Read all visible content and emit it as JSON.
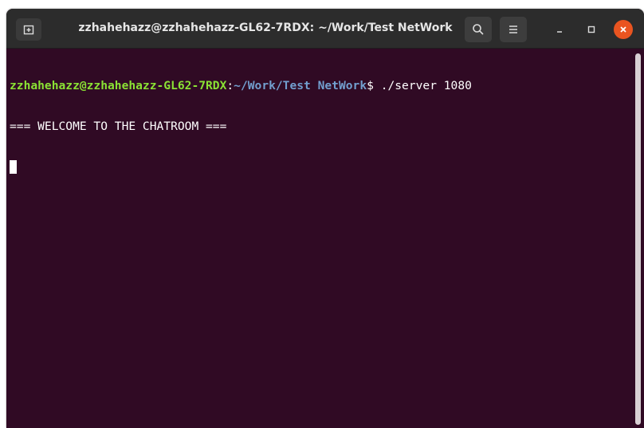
{
  "window": {
    "title": "zzhahehazz@zzhahehazz-GL62-7RDX: ~/Work/Test NetWork"
  },
  "toolbar": {
    "new_tab_icon": "new-tab-icon",
    "search_icon": "search-icon",
    "menu_icon": "hamburger-menu-icon",
    "minimize_icon": "minimize-icon",
    "maximize_icon": "maximize-icon",
    "close_icon": "close-icon"
  },
  "terminal": {
    "prompt_user": "zzhahehazz@zzhahehazz-GL62-7RDX",
    "prompt_colon": ":",
    "prompt_path": "~/Work/Test NetWork",
    "prompt_symbol": "$ ",
    "command": "./server 1080",
    "output_line": "=== WELCOME TO THE CHATROOM ==="
  },
  "colors": {
    "terminal_bg": "#300a24",
    "titlebar_bg": "#2c2c2c",
    "prompt_user": "#8ae234",
    "prompt_path": "#729fcf",
    "close_button": "#e95420"
  }
}
